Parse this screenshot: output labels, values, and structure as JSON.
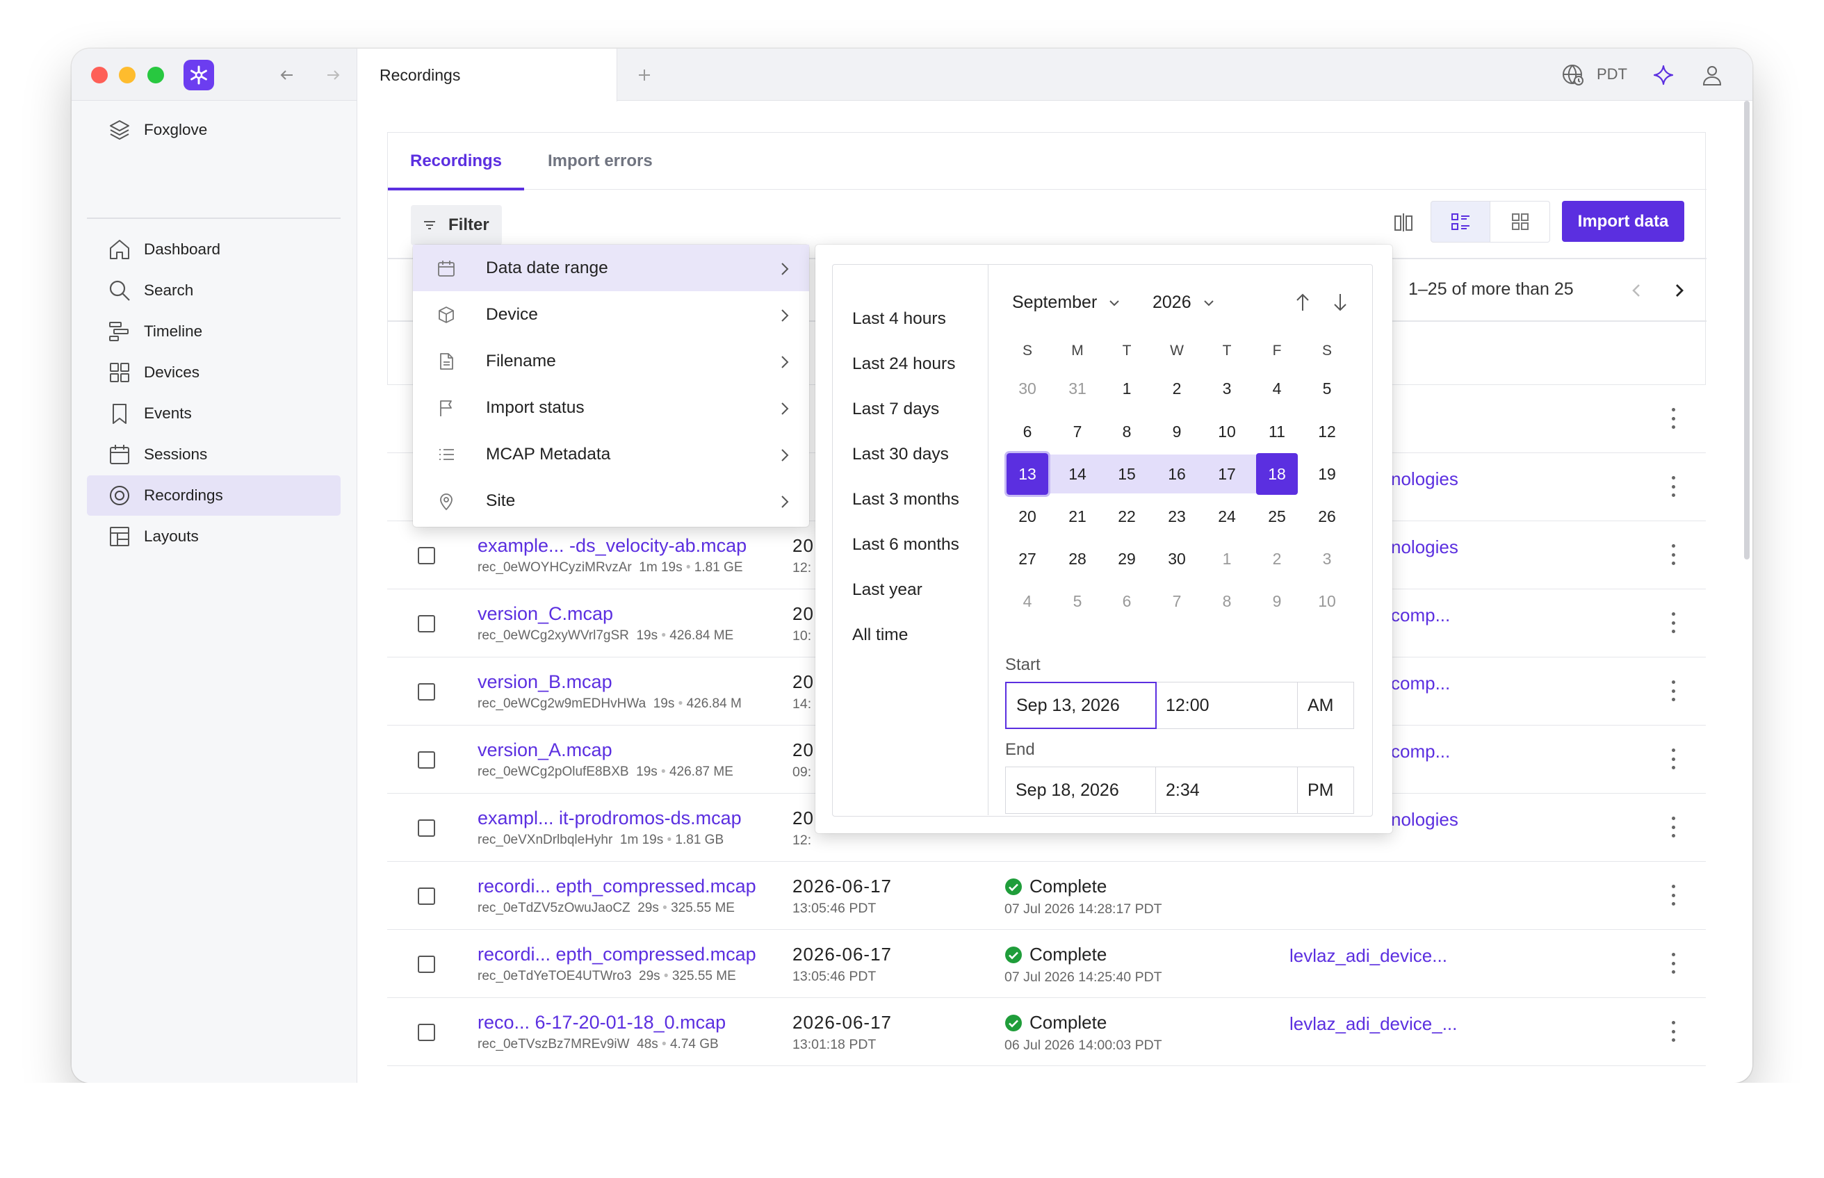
{
  "window": {
    "tab_title": "Recordings",
    "timezone": "PDT"
  },
  "sidebar": {
    "workspace": "Foxglove",
    "items": [
      {
        "label": "Dashboard",
        "icon": "home-icon"
      },
      {
        "label": "Search",
        "icon": "search-icon"
      },
      {
        "label": "Timeline",
        "icon": "timeline-icon"
      },
      {
        "label": "Devices",
        "icon": "devices-icon"
      },
      {
        "label": "Events",
        "icon": "bookmark-icon"
      },
      {
        "label": "Sessions",
        "icon": "calendar-icon"
      },
      {
        "label": "Recordings",
        "icon": "recordings-icon",
        "active": true
      },
      {
        "label": "Layouts",
        "icon": "layouts-icon"
      }
    ]
  },
  "page": {
    "tabs": [
      {
        "label": "Recordings",
        "active": true
      },
      {
        "label": "Import errors",
        "active": false
      }
    ],
    "filter_label": "Filter",
    "import_label": "Import data",
    "pagination": "1–25 of more than 25"
  },
  "filter_menu": {
    "items": [
      {
        "label": "Data date range",
        "icon": "calendar-icon",
        "active": true
      },
      {
        "label": "Device",
        "icon": "cube-icon"
      },
      {
        "label": "Filename",
        "icon": "file-icon"
      },
      {
        "label": "Import status",
        "icon": "flag-icon"
      },
      {
        "label": "MCAP Metadata",
        "icon": "list-icon"
      },
      {
        "label": "Site",
        "icon": "pin-icon"
      }
    ]
  },
  "date_picker": {
    "presets": [
      "Last 4 hours",
      "Last 24 hours",
      "Last 7 days",
      "Last 30 days",
      "Last 3 months",
      "Last 6 months",
      "Last year",
      "All time"
    ],
    "month": "September",
    "year": "2026",
    "weekdays": [
      "S",
      "M",
      "T",
      "W",
      "T",
      "F",
      "S"
    ],
    "weeks": [
      [
        "30",
        "31",
        "1",
        "2",
        "3",
        "4",
        "5"
      ],
      [
        "6",
        "7",
        "8",
        "9",
        "10",
        "11",
        "12"
      ],
      [
        "13",
        "14",
        "15",
        "16",
        "17",
        "18",
        "19"
      ],
      [
        "20",
        "21",
        "22",
        "23",
        "24",
        "25",
        "26"
      ],
      [
        "27",
        "28",
        "29",
        "30",
        "1",
        "2",
        "3"
      ],
      [
        "4",
        "5",
        "6",
        "7",
        "8",
        "9",
        "10"
      ]
    ],
    "muted_before": 2,
    "muted_after_row4": 3,
    "range_start": "13",
    "range_end": "18",
    "start_label": "Start",
    "start_date": "Sep 13, 2026",
    "start_time": "12:00",
    "start_ampm": "AM",
    "end_label": "End",
    "end_date": "Sep 18, 2026",
    "end_time": "2:34",
    "end_ampm": "PM"
  },
  "rows": [
    {
      "name": "example... -ds_velocity-ab.mcap",
      "id": "rec_0eWOYHCyziMRvzAr",
      "duration": "1m 19s",
      "size": "1.81 GE",
      "date": "20",
      "time": "12:",
      "status": "",
      "status_time": "",
      "device": "nologies"
    },
    {
      "name": "version_C.mcap",
      "id": "rec_0eWCg2xyWVrl7gSR",
      "duration": "19s",
      "size": "426.84 ME",
      "date": "20",
      "time": "10:",
      "status": "",
      "status_time": "",
      "device": "comp..."
    },
    {
      "name": "version_B.mcap",
      "id": "rec_0eWCg2w9mEDHvHWa",
      "duration": "19s",
      "size": "426.84 M",
      "date": "20",
      "time": "14:",
      "status": "",
      "status_time": "",
      "device": "comp..."
    },
    {
      "name": "version_A.mcap",
      "id": "rec_0eWCg2pOlufE8BXB",
      "duration": "19s",
      "size": "426.87 ME",
      "date": "20",
      "time": "09:",
      "status": "",
      "status_time": "",
      "device": "comp..."
    },
    {
      "name": "exampl... it-prodromos-ds.mcap",
      "id": "rec_0eVXnDrlbqleHyhr",
      "duration": "1m 19s",
      "size": "1.81 GB",
      "date": "20",
      "time": "12:",
      "status": "",
      "status_time": "",
      "device": "nologies"
    },
    {
      "name": "recordi... epth_compressed.mcap",
      "id": "rec_0eTdZV5zOwuJaoCZ",
      "duration": "29s",
      "size": "325.55 ME",
      "date": "2026-06-17",
      "time": "13:05:46 PDT",
      "status": "Complete",
      "status_time": "07 Jul 2026 14:28:17 PDT",
      "device": ""
    },
    {
      "name": "recordi... epth_compressed.mcap",
      "id": "rec_0eTdYeTOE4UTWro3",
      "duration": "29s",
      "size": "325.55 ME",
      "date": "2026-06-17",
      "time": "13:05:46 PDT",
      "status": "Complete",
      "status_time": "07 Jul 2026 14:25:40 PDT",
      "device": "levlaz_adi_device..."
    },
    {
      "name": "reco... 6-17-20-01-18_0.mcap",
      "id": "rec_0eTVszBz7MREv9iW",
      "duration": "48s",
      "size": "4.74 GB",
      "date": "2026-06-17",
      "time": "13:01:18 PDT",
      "status": "Complete",
      "status_time": "06 Jul 2026 14:00:03 PDT",
      "device": "levlaz_adi_device_..."
    }
  ]
}
